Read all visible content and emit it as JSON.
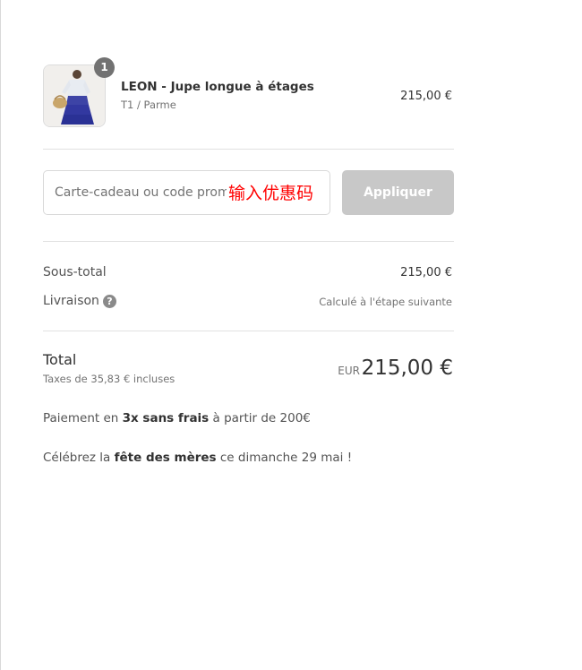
{
  "product": {
    "quantity": "1",
    "name": "LEON - Jupe longue à étages",
    "variant": "T1 / Parme",
    "price": "215,00 €",
    "image": "product-thumbnail-icon"
  },
  "discount": {
    "placeholder": "Carte-cadeau ou code promo",
    "annotation": "输入优惠码",
    "apply_label": "Appliquer"
  },
  "summary": {
    "subtotal_label": "Sous-total",
    "subtotal_value": "215,00 €",
    "shipping_label": "Livraison",
    "shipping_help_icon": "question-mark-icon",
    "shipping_value": "Calculé à l'étape suivante"
  },
  "total": {
    "label": "Total",
    "taxes": "Taxes de 35,83 € incluses",
    "currency": "EUR",
    "amount": "215,00 €"
  },
  "notes": {
    "payment_prefix": "Paiement en ",
    "payment_bold": "3x sans frais",
    "payment_suffix": " à partir de 200€",
    "mothers_prefix": "Célébrez la ",
    "mothers_bold": "fête des mères",
    "mothers_suffix": " ce dimanche 29 mai !"
  },
  "colors": {
    "annotation": "#ff0000",
    "apply_button_disabled": "#c8c8c8",
    "badge": "#727272"
  }
}
